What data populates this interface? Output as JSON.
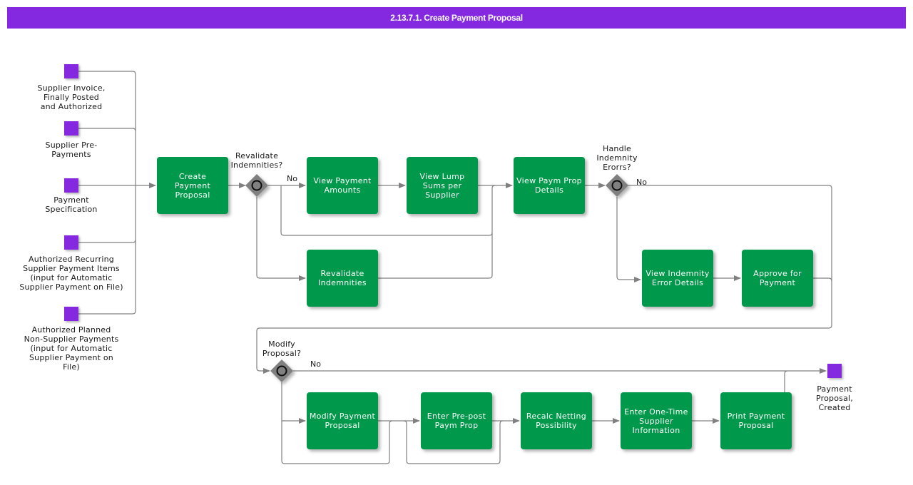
{
  "title": "2.13.7.1. Create Payment Proposal",
  "colors": {
    "header": "#8529e0",
    "task": "#00984a",
    "event": "#8529e0",
    "gateway": "#808080",
    "connector": "#808080"
  },
  "start_events": [
    {
      "label": "Supplier Invoice,\nFinally Posted\nand Authorized"
    },
    {
      "label": "Supplier Pre-\nPayments"
    },
    {
      "label": "Payment\nSpecification"
    },
    {
      "label": "Authorized Recurring\nSupplier Payment Items\n(input for Automatic\nSupplier Payment on File)"
    },
    {
      "label": "Authorized Planned\nNon-Supplier Payments\n(input for Automatic\nSupplier Payment on\nFile)"
    }
  ],
  "end_event": {
    "label": "Payment\nProposal,\nCreated"
  },
  "tasks": {
    "create_payment_proposal": "Create Payment Proposal",
    "view_payment_amounts": "View Payment Amounts",
    "view_lump_sums": "View Lump Sums per Supplier",
    "view_paym_prop_details": "View Paym Prop Details",
    "revalidate_indemnities": "Revalidate Indemnities",
    "view_indemnity_error_details": "View Indemnity Error Details",
    "approve_for_payment": "Approve for Payment",
    "modify_payment_proposal": "Modify Payment Proposal",
    "enter_prepost_paym_prop": "Enter Pre-post Paym Prop",
    "recalc_netting": "Recalc Netting Possibility",
    "enter_one_time_supplier": "Enter One-Time Supplier Information",
    "print_payment_proposal": "Print Payment Proposal"
  },
  "gateways": {
    "revalidate": {
      "label": "Revalidate\nIndemnities?",
      "no_label": "No"
    },
    "handle_errors": {
      "label": "Handle\nIndemnity\nErorrs?",
      "no_label": "No"
    },
    "modify": {
      "label": "Modify\nProposal?",
      "no_label": "No"
    }
  }
}
